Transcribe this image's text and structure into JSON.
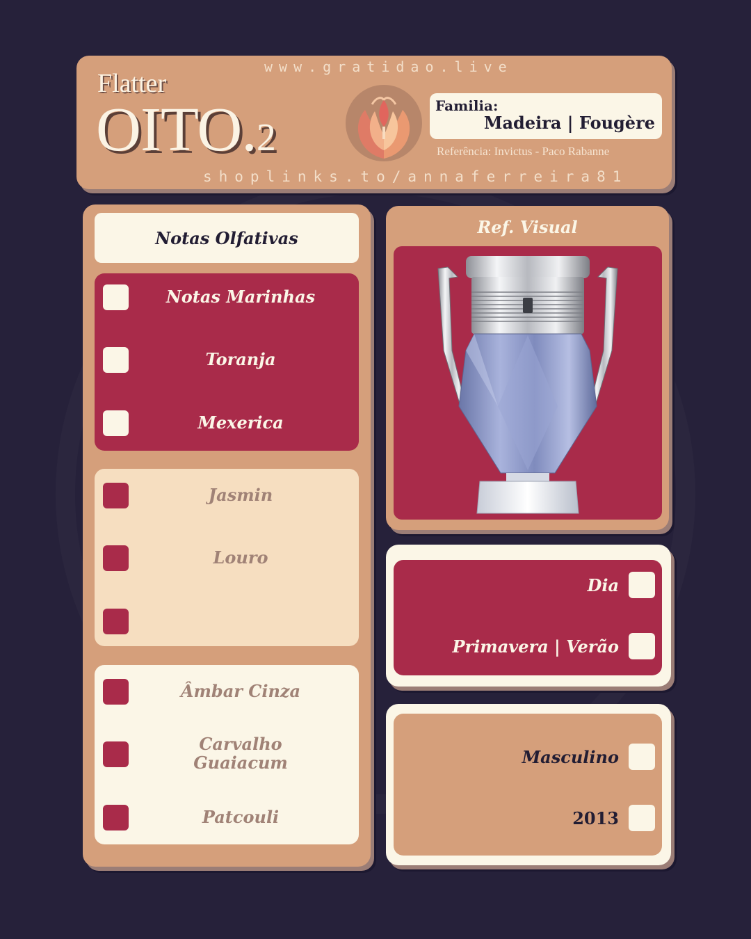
{
  "header": {
    "brand_small": "Flatter",
    "brand_big": "OITO.",
    "brand_suffix": "2",
    "url_top": "www.gratidao.live",
    "url_bottom": "shoplinks.to/annaferreira81",
    "familia_label": "Familia:",
    "familia_value": "Madeira | Fougère",
    "referencia": "Referência: Invictus - Paco Rabanne"
  },
  "notes": {
    "title": "Notas Olfativas",
    "top": [
      "Notas Marinhas",
      "Toranja",
      "Mexerica"
    ],
    "heart": [
      "Jasmin",
      "Louro",
      ""
    ],
    "base": [
      "Âmbar Cinza",
      "Carvalho Guaiacum",
      "Patcouli"
    ]
  },
  "ref_visual": {
    "title": "Ref. Visual"
  },
  "occasion": {
    "time": "Dia",
    "season": "Primavera | Verão"
  },
  "profile": {
    "gender": "Masculino",
    "year": "2013"
  },
  "colors": {
    "background": "#26213a",
    "tan": "#d59f7b",
    "crimson": "#a92b4a",
    "cream": "#fbf6e7",
    "peach": "#f6dec0"
  }
}
